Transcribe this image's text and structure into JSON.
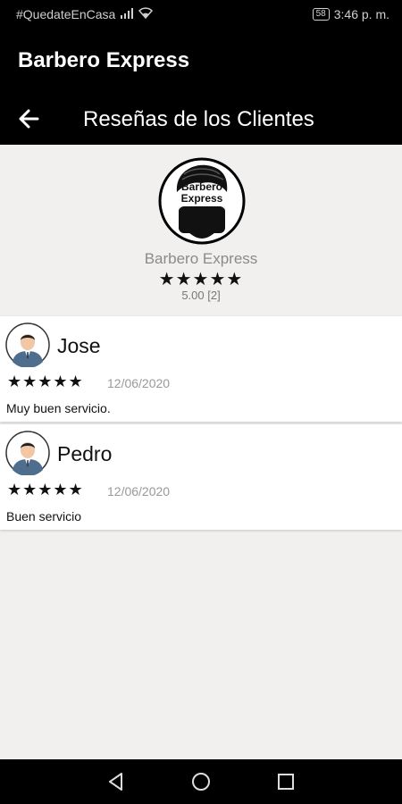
{
  "status_bar": {
    "carrier_text": "#QuedateEnCasa",
    "battery": "58",
    "time": "3:46 p. m."
  },
  "app_bar": {
    "app_title": "Barbero Express",
    "screen_title": "Reseñas de los Clientes",
    "back_icon": "arrow-left-icon"
  },
  "shop": {
    "logo_text_line1": "Barbero",
    "logo_text_line2": "Express",
    "name": "Barbero Express",
    "stars": "★★★★★",
    "rating": "5.00 [2]"
  },
  "reviews": [
    {
      "name": "Jose",
      "stars": "★★★★★",
      "date": "12/06/2020",
      "comment": "Muy buen servicio."
    },
    {
      "name": "Pedro",
      "stars": "★★★★★",
      "date": "12/06/2020",
      "comment": "Buen servicio"
    }
  ],
  "nav": {
    "back": "triangle-back-icon",
    "home": "circle-home-icon",
    "recents": "square-recents-icon"
  },
  "colors": {
    "background": "#f2f0ef",
    "bar": "#000000",
    "card": "#ffffff"
  }
}
